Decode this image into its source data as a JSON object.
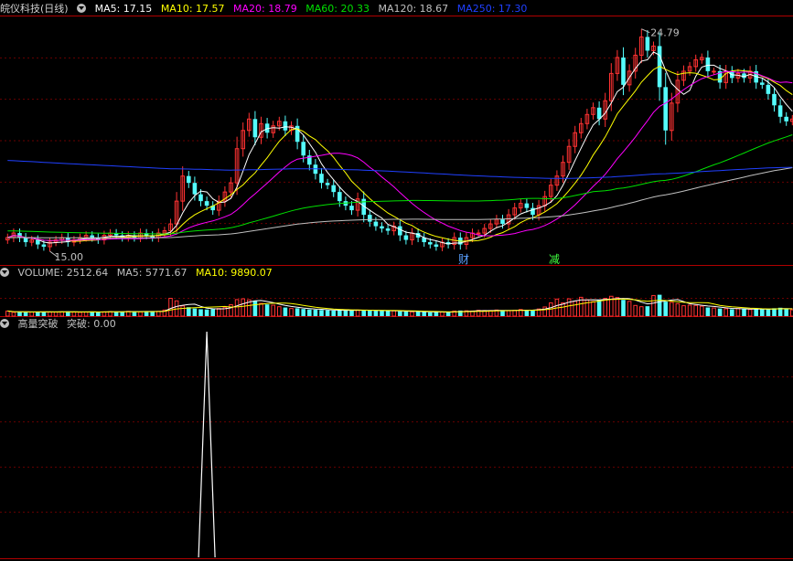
{
  "colors": {
    "up": "#ff3232",
    "down": "#54fcfc",
    "grid": "#6a0000",
    "border": "#b00000",
    "ma5": "#ffffff",
    "ma10": "#ffff00",
    "ma20": "#ff00ff",
    "ma60": "#00e000",
    "ma120": "#c0c0c0",
    "ma250": "#2040ff",
    "label": "#c0c0c0",
    "bg": "#000000"
  },
  "price_panel": {
    "title": "皖仪科技(日线)",
    "indicators": [
      {
        "key": "ma5",
        "text": "MA5: 17.15"
      },
      {
        "key": "ma10",
        "text": "MA10: 17.57"
      },
      {
        "key": "ma20",
        "text": "MA20: 18.79"
      },
      {
        "key": "ma60",
        "text": "MA60: 20.33"
      },
      {
        "key": "ma120",
        "text": "MA120: 18.67"
      },
      {
        "key": "ma250",
        "text": "MA250: 17.30"
      }
    ],
    "high_label": "24.79",
    "low_label": "15.00",
    "markers": [
      {
        "text": "财",
        "index": 75,
        "color": "#5aa0ff"
      },
      {
        "text": "减",
        "index": 90,
        "color": "#40ff40"
      }
    ]
  },
  "volume_panel": {
    "indicators": [
      {
        "key": "label",
        "text": "VOLUME: 2512.64"
      },
      {
        "key": "label",
        "text": "MA5: 5771.67"
      },
      {
        "key": "ma10",
        "text": "MA10: 9890.07"
      }
    ]
  },
  "signal_panel": {
    "indicators": [
      {
        "key": "label",
        "text": "高量突破"
      },
      {
        "key": "label",
        "text": "突破: 0.00"
      }
    ]
  },
  "chart_data": {
    "type": "candlestick",
    "price_range": [
      14.4,
      25.3
    ],
    "volume_max": 14000,
    "signal_range": [
      0,
      1
    ],
    "close": [
      15.6,
      15.8,
      15.6,
      15.4,
      15.5,
      15.3,
      15.2,
      15.4,
      15.5,
      15.6,
      15.4,
      15.5,
      15.6,
      15.7,
      15.6,
      15.5,
      15.7,
      15.8,
      15.7,
      15.6,
      15.7,
      15.6,
      15.8,
      15.7,
      15.6,
      15.8,
      15.9,
      16.2,
      17.2,
      18.3,
      18.0,
      17.5,
      17.2,
      17.0,
      16.8,
      17.2,
      17.6,
      18.0,
      19.5,
      20.3,
      20.8,
      20.0,
      20.6,
      20.2,
      20.5,
      20.7,
      20.3,
      20.5,
      19.8,
      19.2,
      18.8,
      18.4,
      18.0,
      17.9,
      17.6,
      17.2,
      17.0,
      16.8,
      17.3,
      16.6,
      16.3,
      16.1,
      16.0,
      15.9,
      16.1,
      15.7,
      15.5,
      15.8,
      15.6,
      15.4,
      15.3,
      15.2,
      15.4,
      15.3,
      15.6,
      15.3,
      15.6,
      15.8,
      15.8,
      16.0,
      16.2,
      16.4,
      16.2,
      16.6,
      16.9,
      17.1,
      16.9,
      16.6,
      17.0,
      17.4,
      17.9,
      18.3,
      18.9,
      19.6,
      20.2,
      20.6,
      21.0,
      21.3,
      20.8,
      21.6,
      22.8,
      23.5,
      22.3,
      22.9,
      23.6,
      24.4,
      23.8,
      24.0,
      22.2,
      20.3,
      21.5,
      22.5,
      22.9,
      23.1,
      23.4,
      23.5,
      22.9,
      22.9,
      22.4,
      22.9,
      22.6,
      22.8,
      22.6,
      22.9,
      22.4,
      22.3,
      21.9,
      21.4,
      20.9,
      20.7,
      20.8
    ],
    "volume": [
      2000,
      1500,
      1700,
      1500,
      1600,
      1800,
      1700,
      1600,
      1600,
      1700,
      1900,
      1600,
      1500,
      1600,
      1700,
      1600,
      1700,
      1800,
      1700,
      1800,
      1900,
      1800,
      1700,
      1900,
      1800,
      1900,
      2400,
      7000,
      6000,
      4000,
      3500,
      3000,
      2700,
      2600,
      2800,
      3000,
      3500,
      4500,
      6500,
      6800,
      6400,
      6000,
      5000,
      4600,
      4300,
      3700,
      3400,
      3000,
      3100,
      2800,
      2600,
      2500,
      2400,
      2300,
      2200,
      2200,
      2400,
      2300,
      2400,
      2300,
      2200,
      2100,
      2100,
      2000,
      2100,
      1900,
      1800,
      1700,
      1800,
      1600,
      1500,
      1700,
      1600,
      1500,
      2000,
      2200,
      2100,
      2000,
      2300,
      2200,
      2200,
      2400,
      2200,
      2100,
      2300,
      2600,
      2400,
      2500,
      2800,
      3600,
      5200,
      6700,
      5200,
      6800,
      5900,
      7400,
      6400,
      5700,
      6400,
      7000,
      7800,
      7300,
      6400,
      5800,
      4200,
      3700,
      3900,
      8100,
      8400,
      5700,
      5400,
      4900,
      4100,
      4300,
      4200,
      3900,
      3400,
      3200,
      3000,
      2900,
      2700,
      3000,
      2800,
      2600,
      2900,
      2700,
      2700,
      3100,
      3300,
      3000,
      2500
    ],
    "signal_peak_index": 33
  }
}
